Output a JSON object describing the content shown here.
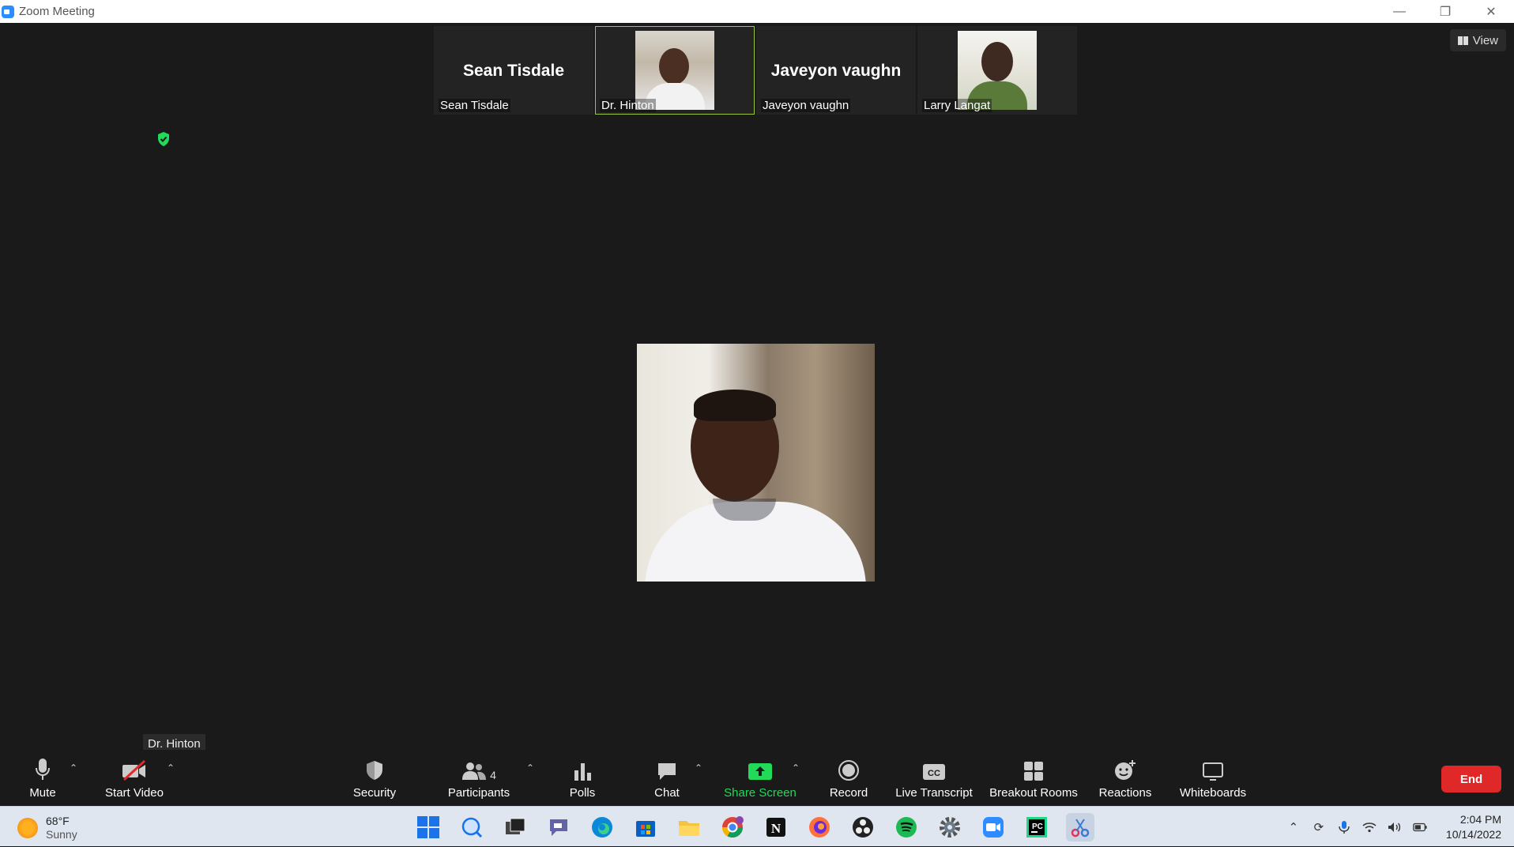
{
  "window": {
    "title": "Zoom Meeting"
  },
  "view_button": {
    "label": "View"
  },
  "participants_strip": [
    {
      "name": "Sean Tisdale",
      "big_name": "Sean Tisdale",
      "has_video": false,
      "active": false
    },
    {
      "name": "Dr. Hinton",
      "big_name": "",
      "has_video": true,
      "active": true
    },
    {
      "name": "Javeyon vaughn",
      "big_name": "Javeyon vaughn",
      "has_video": false,
      "active": false
    },
    {
      "name": "Larry Langat",
      "big_name": "",
      "has_video": true,
      "active": false
    }
  ],
  "tooltip": "Dr. Hinton",
  "toolbar": {
    "mute": "Mute",
    "start_video": "Start Video",
    "security": "Security",
    "participants": "Participants",
    "participants_count": "4",
    "polls": "Polls",
    "chat": "Chat",
    "share_screen": "Share Screen",
    "record": "Record",
    "live_transcript": "Live Transcript",
    "breakout_rooms": "Breakout Rooms",
    "reactions": "Reactions",
    "whiteboards": "Whiteboards",
    "end": "End"
  },
  "taskbar": {
    "weather_temp": "68°F",
    "weather_desc": "Sunny",
    "time": "2:04 PM",
    "date": "10/14/2022",
    "apps": [
      "windows-start",
      "search",
      "task-view",
      "teams-chat",
      "edge",
      "microsoft-store",
      "file-explorer",
      "chrome",
      "notion",
      "firefox",
      "obs",
      "spotify",
      "settings",
      "zoom",
      "pycharm",
      "snipping-tool"
    ]
  },
  "colors": {
    "accent_green": "#23d959",
    "active_border": "#9ac73e",
    "end_red": "#e02828",
    "zoom_blue": "#2d8cff"
  }
}
